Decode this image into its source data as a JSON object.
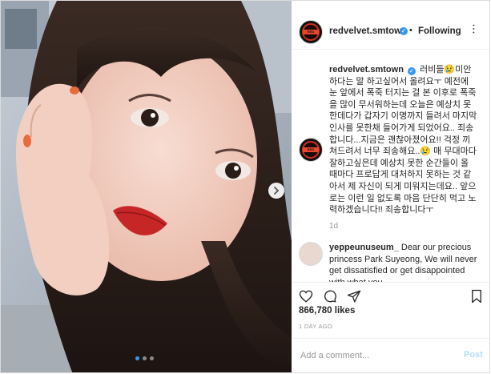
{
  "post": {
    "username": "redvelvet.smtown",
    "follow_separator": "•",
    "follow_label": "Following",
    "more_icon_text": "...",
    "caption_username": "redvelvet.smtown",
    "caption_text": "러비들😢미안하다는 말 하고싶어서 올려요ㅜ 예전에 눈 앞에서 폭죽 터지는 걸 본 이후로 폭죽을 많이 무서워하는데 오늘은 예상치 못한데다가 갑자기 이명까지 들려서 마지막 인사를 못한채 들어가게 되었어요.. 죄송합니다...지금은 괜찮아졌어요!! 걱정 끼쳐드려서 너무 죄송해요..😢 매 무대마다 잘하고싶은데 예상치 못한 순간들이 올 때마다 프로답게 대처하지 못하는 것 같아서 제 자신이 되게 미워지는데요.. 앞으로는 이런 일 없도록 마음 단단히 먹고 노력하겠습니다!! 죄송합니다ㅜ",
    "caption_time": "1d",
    "comment_username": "yeppeunuseum_",
    "comment_text": "Dear our precious princess Park Suyeong, We will never get dissatisfied or get disappointed with what you",
    "likes": "866,780 likes",
    "posted_ago": "1 DAY AGO",
    "add_comment_placeholder": "Add a comment...",
    "post_label": "Post",
    "avatar_logo": "RED VELVET"
  },
  "carousel": {
    "current_index": 1,
    "total": 3
  },
  "colors": {
    "accent": "#3897f0",
    "post_disabled": "#b2dffc",
    "brand_red": "#e7472a"
  },
  "icons": [
    "verified-badge-icon",
    "heart-icon",
    "comment-icon",
    "share-icon",
    "bookmark-icon",
    "chevron-right-icon"
  ]
}
